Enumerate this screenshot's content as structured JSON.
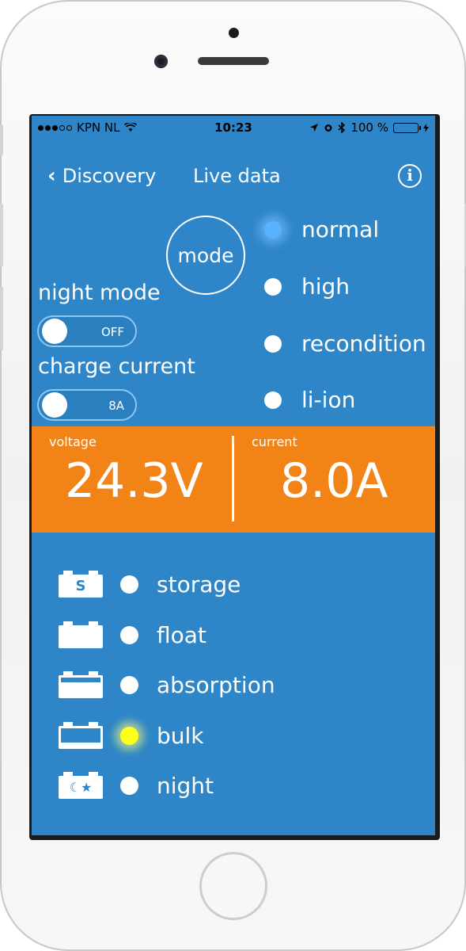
{
  "status_bar": {
    "carrier": "KPN NL",
    "time": "10:23",
    "battery": "100 %",
    "battery_color": "#3bd23b"
  },
  "nav": {
    "back_label": "Discovery",
    "title": "Live data",
    "info_icon": "info-icon"
  },
  "mode": {
    "label": "mode",
    "options": [
      {
        "label": "normal",
        "active": true
      },
      {
        "label": "high",
        "active": false
      },
      {
        "label": "recondition",
        "active": false
      },
      {
        "label": "li-ion",
        "active": false
      }
    ]
  },
  "night_mode": {
    "label": "night mode",
    "value": "OFF"
  },
  "charge_current": {
    "label": "charge current",
    "value": "8A"
  },
  "metrics": {
    "voltage_label": "voltage",
    "voltage_value": "24.3V",
    "current_label": "current",
    "current_value": "8.0A",
    "panel_color": "#f28316"
  },
  "charge_states": [
    {
      "label": "storage",
      "icon": "battery-storage-icon",
      "active": false
    },
    {
      "label": "float",
      "icon": "battery-float-icon",
      "active": false
    },
    {
      "label": "absorption",
      "icon": "battery-absorption-icon",
      "active": false
    },
    {
      "label": "bulk",
      "icon": "battery-bulk-icon",
      "active": true
    },
    {
      "label": "night",
      "icon": "battery-night-icon",
      "active": false
    }
  ],
  "colors": {
    "background": "#2e86c8",
    "active_mode": "#58b2ff",
    "active_state": "#ffff1e"
  }
}
